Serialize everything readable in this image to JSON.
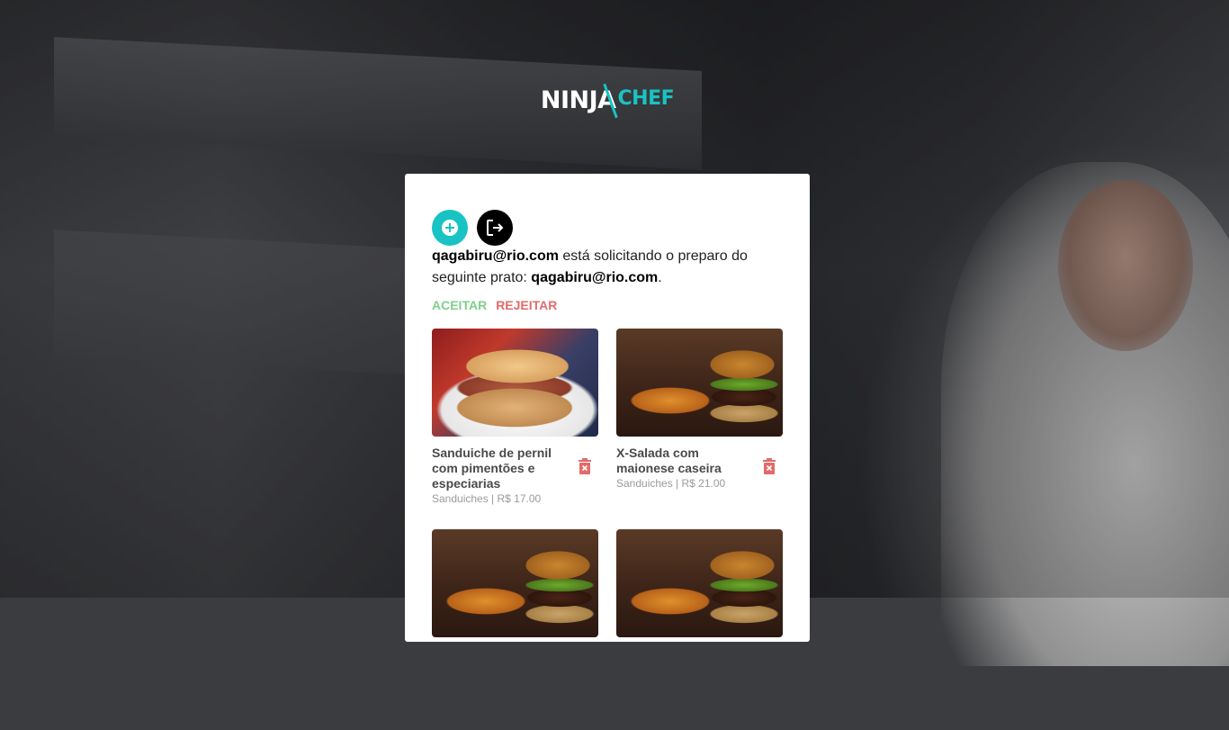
{
  "brand": {
    "ninja": "NINJA",
    "chef": "CHEF"
  },
  "actions": {
    "add_icon": "plus-circle-icon",
    "logout_icon": "logout-icon"
  },
  "request": {
    "requester": "qagabiru@rio.com",
    "text_middle": " está solicitando o preparo do seguinte prato: ",
    "dish": "qagabiru@rio.com",
    "text_end": "."
  },
  "decision": {
    "accept_label": "Aceitar",
    "reject_label": "Rejeitar"
  },
  "colors": {
    "accent": "#19c3c3",
    "accept": "#7fd08a",
    "reject": "#e26a6a"
  },
  "dishes": [
    {
      "name": "Sanduiche de pernil com pimentões e especiarias",
      "category": "Sanduiches",
      "price": "R$ 17.00",
      "meta": "Sanduiches | R$ 17.00"
    },
    {
      "name": "X-Salada com maionese caseira",
      "category": "Sanduiches",
      "price": "R$ 21.00",
      "meta": "Sanduiches | R$ 21.00"
    },
    {
      "name": "",
      "meta": ""
    },
    {
      "name": "",
      "meta": ""
    }
  ]
}
